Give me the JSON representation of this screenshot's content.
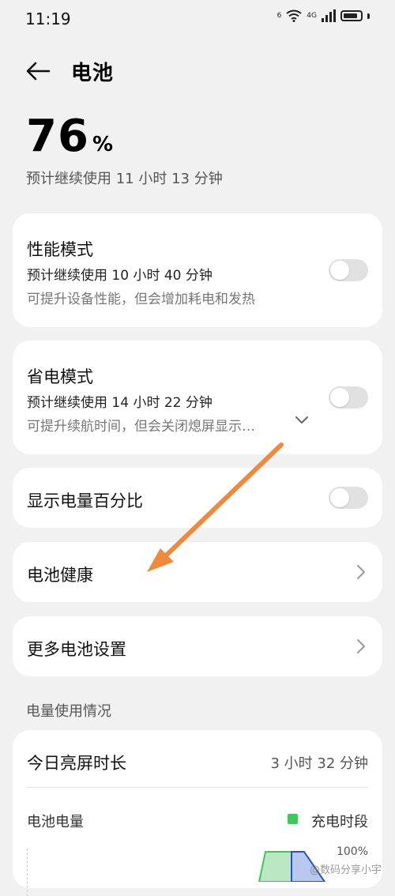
{
  "status_bar": {
    "time": "11:19",
    "signal_tag": "6",
    "network_tag": "4G"
  },
  "header": {
    "title": "电池"
  },
  "battery": {
    "percent": "76",
    "percent_sign": "%",
    "estimate": "预计继续使用 11 小时 13 分钟"
  },
  "performance_mode": {
    "title": "性能模式",
    "estimate": "预计继续使用 10 小时 40 分钟",
    "description": "可提升设备性能，但会增加耗电和发热",
    "enabled": false
  },
  "power_saving_mode": {
    "title": "省电模式",
    "estimate": "预计继续使用 14 小时 22 分钟",
    "description": "可提升续航时间，但会关闭熄屏显示…",
    "enabled": false
  },
  "show_percentage": {
    "title": "显示电量百分比",
    "enabled": false
  },
  "battery_health": {
    "title": "电池健康"
  },
  "more_settings": {
    "title": "更多电池设置"
  },
  "usage": {
    "section_label": "电量使用情况",
    "screen_on_label": "今日亮屏时长",
    "screen_on_value": "3 小时 32 分钟",
    "battery_level_label": "电池电量",
    "legend_charging": "充电时段",
    "axis_max": "100%"
  },
  "watermark": "@数码分享小宇",
  "colors": {
    "charging": "#3fc75a",
    "annotation_arrow": "#ef8a3c"
  }
}
